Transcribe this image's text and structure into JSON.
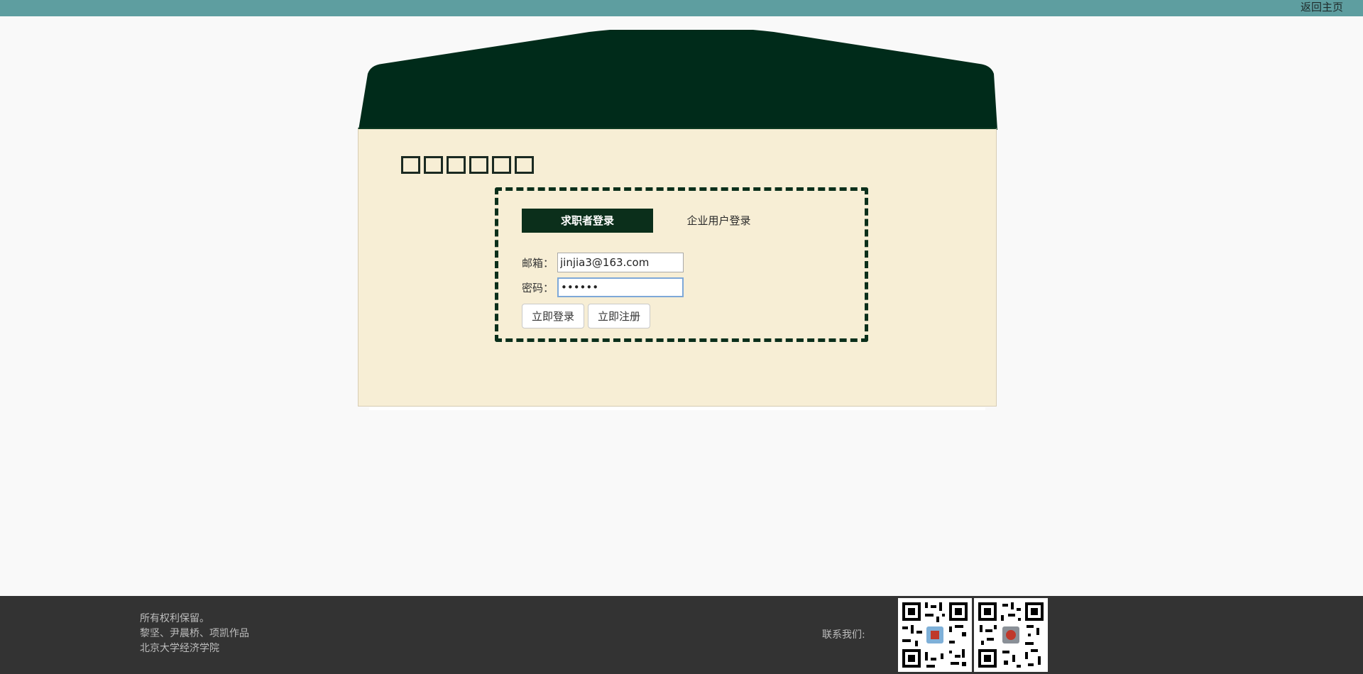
{
  "header": {
    "home_link": "返回主页"
  },
  "login": {
    "postcode_boxes": 6,
    "tabs": [
      {
        "label": "求职者登录",
        "active": true
      },
      {
        "label": "企业用户登录",
        "active": false
      }
    ],
    "email_label": "邮箱：",
    "email_value": "jinjia3@163.com",
    "password_label": "密码：",
    "password_value": "••••••",
    "login_button": "立即登录",
    "register_button": "立即注册"
  },
  "footer": {
    "lines": [
      "所有权利保留。",
      "黎坚、尹晨桥、项凯作品",
      "北京大学经济学院"
    ],
    "contact_label": "联系我们:"
  },
  "colors": {
    "topbar": "#5e9ea0",
    "envelope_flap": "#002b1a",
    "envelope_body": "#f7eed5",
    "footer": "#333333"
  }
}
